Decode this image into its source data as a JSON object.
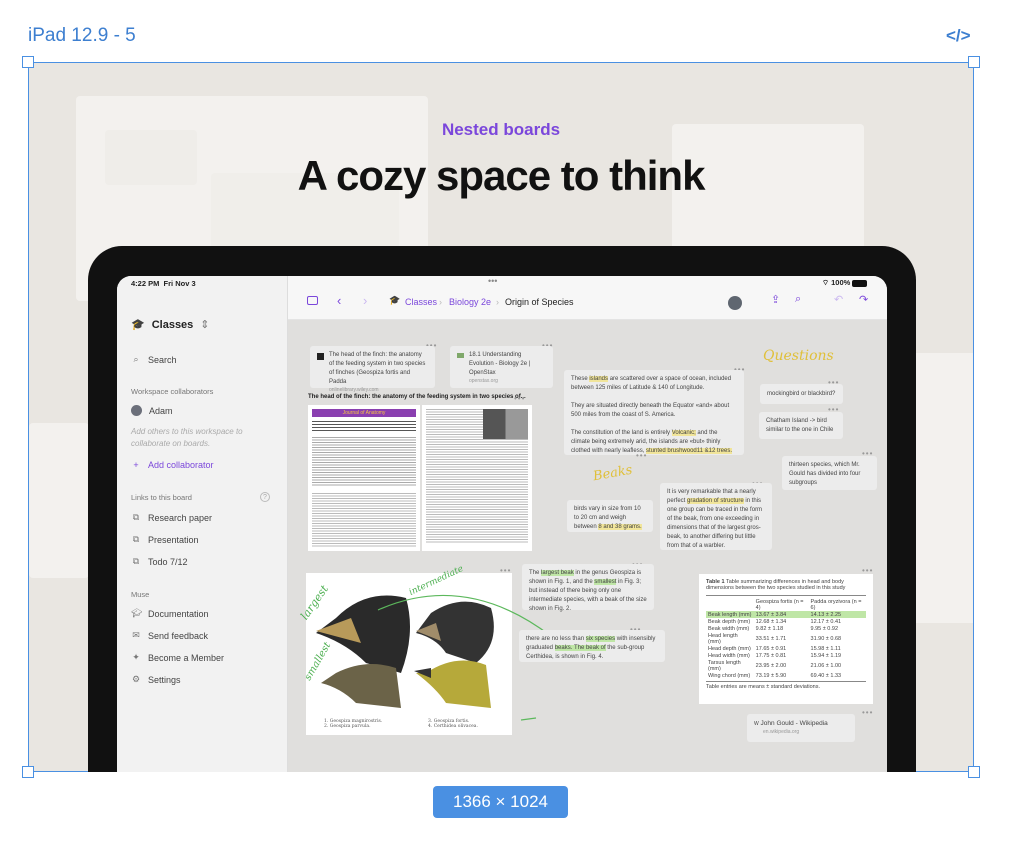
{
  "frame": {
    "label": "iPad 12.9 - 5",
    "dimensions": "1366 × 1024",
    "code_icon": "code-icon",
    "accent": "#4a90e2"
  },
  "hero": {
    "eyebrow": "Nested boards",
    "headline": "A cozy space to think",
    "eyebrow_color": "#7b47db"
  },
  "status_bar": {
    "time": "4:22 PM",
    "date": "Fri Nov 3",
    "battery": "100%"
  },
  "sidebar": {
    "workspace": "Classes",
    "search": "Search",
    "collaborators_heading": "Workspace collaborators",
    "collaborator": "Adam",
    "collab_hint": "Add others to this workspace to collaborate on boards.",
    "add_collaborator": "Add collaborator",
    "links_heading": "Links to this board",
    "links": [
      "Research paper",
      "Presentation",
      "Todo 7/12"
    ],
    "muse_heading": "Muse",
    "muse_items": [
      "Documentation",
      "Send feedback",
      "Become a Member",
      "Settings"
    ]
  },
  "toolbar": {
    "breadcrumb": [
      "Classes",
      "Biology 2e",
      "Origin of Species"
    ]
  },
  "board": {
    "link_cards": [
      {
        "title": "The head of the finch: the anatomy of the feeding system in two species of finches (Geospiza fortis and Padda",
        "domain": "onlinelibrary.wiley.com"
      },
      {
        "title": "18.1 Understanding Evolution - Biology 2e | OpenStax",
        "domain": "openstax.org"
      },
      {
        "title": "John Gould - Wikipedia",
        "domain": "en.wikipedia.org"
      }
    ],
    "paper_title": "The head of the finch: the anatomy of the feeding system in two species of...",
    "paper_journal": "Journal of Anatomy",
    "handwriting": {
      "questions": "Questions",
      "beaks": "Beaks",
      "largest": "largest",
      "intermediate": "intermediate",
      "smallest": "smallest"
    },
    "notes": {
      "islands_p1": [
        "These ",
        "islands",
        " are scattered over a space of ocean, included between 125 miles of Latitude & 140 of Longitude."
      ],
      "islands_p2": "They are situated directly beneath the Equator «and» about 500 miles from the coast of S. America.",
      "islands_p3": [
        "The constitution of the land is entirely ",
        "Volcanic;",
        " and the climate being extremely arid, the islands are «but» thinly clothed with nearly leafless, ",
        "stunted brushwood11 &12 trees."
      ],
      "q1": "mockingbird or blackbird?",
      "q2": "Chatham Island -> bird similar to the one in Chile",
      "q3": "thirteen species, which Mr. Gould has divided into four subgroups",
      "beak_size": [
        "birds vary in size from 10 to 20 cm and weigh between ",
        "8 and 38 grams."
      ],
      "gradation": [
        "It is very remarkable that a nearly perfect ",
        "gradation of structure",
        " in this one group can be traced in the form of the beak, from one exceeding in dimensions that of the largest gros-beak, to another differing but little from that of a warbler."
      ],
      "largest": [
        "The ",
        "largest beak",
        " in the genus Geospiza is shown in Fig. 1, and the ",
        "smallest",
        " in Fig. 3; but instead of there being only one intermediate species, with a beak of the size shown in Fig. 2."
      ],
      "six_species": [
        "there are no less than ",
        "six species",
        " with insensibly graduated ",
        "beaks. The beak of",
        " the sub-group Certhidea, is shown in Fig. 4."
      ]
    },
    "bird_captions": [
      "1. Geospiza magnirostris.",
      "2. Geospiza parvula.",
      "3. Geospiza fortis.",
      "4. Certhidea olivacea."
    ],
    "table": {
      "caption_label": "Table 1",
      "caption": "Table summarizing differences in head and body dimensions between the two species studied in this study",
      "col1": "Geospiza fortis (n = 4)",
      "col2": "Padda oryzivora (n = 6)",
      "rows": [
        [
          "Beak length (mm)",
          "13.67 ± 3.84",
          "14.13 ± 2.25"
        ],
        [
          "Beak depth (mm)",
          "12.68 ± 1.34",
          "12.17 ± 0.41"
        ],
        [
          "Beak width (mm)",
          "9.82 ± 1.18",
          "9.95 ± 0.92"
        ],
        [
          "Head length (mm)",
          "33.51 ± 1.71",
          "31.90 ± 0.68"
        ],
        [
          "Head depth (mm)",
          "17.65 ± 0.91",
          "15.98 ± 1.11"
        ],
        [
          "Head width (mm)",
          "17.75 ± 0.81",
          "15.94 ± 1.19"
        ],
        [
          "Tarsus length (mm)",
          "23.95 ± 2.00",
          "21.06 ± 1.00"
        ],
        [
          "Wing chord (mm)",
          "73.19 ± 5.90",
          "69.40 ± 1.33"
        ]
      ],
      "footer": "Table entries are means ± standard deviations."
    }
  }
}
